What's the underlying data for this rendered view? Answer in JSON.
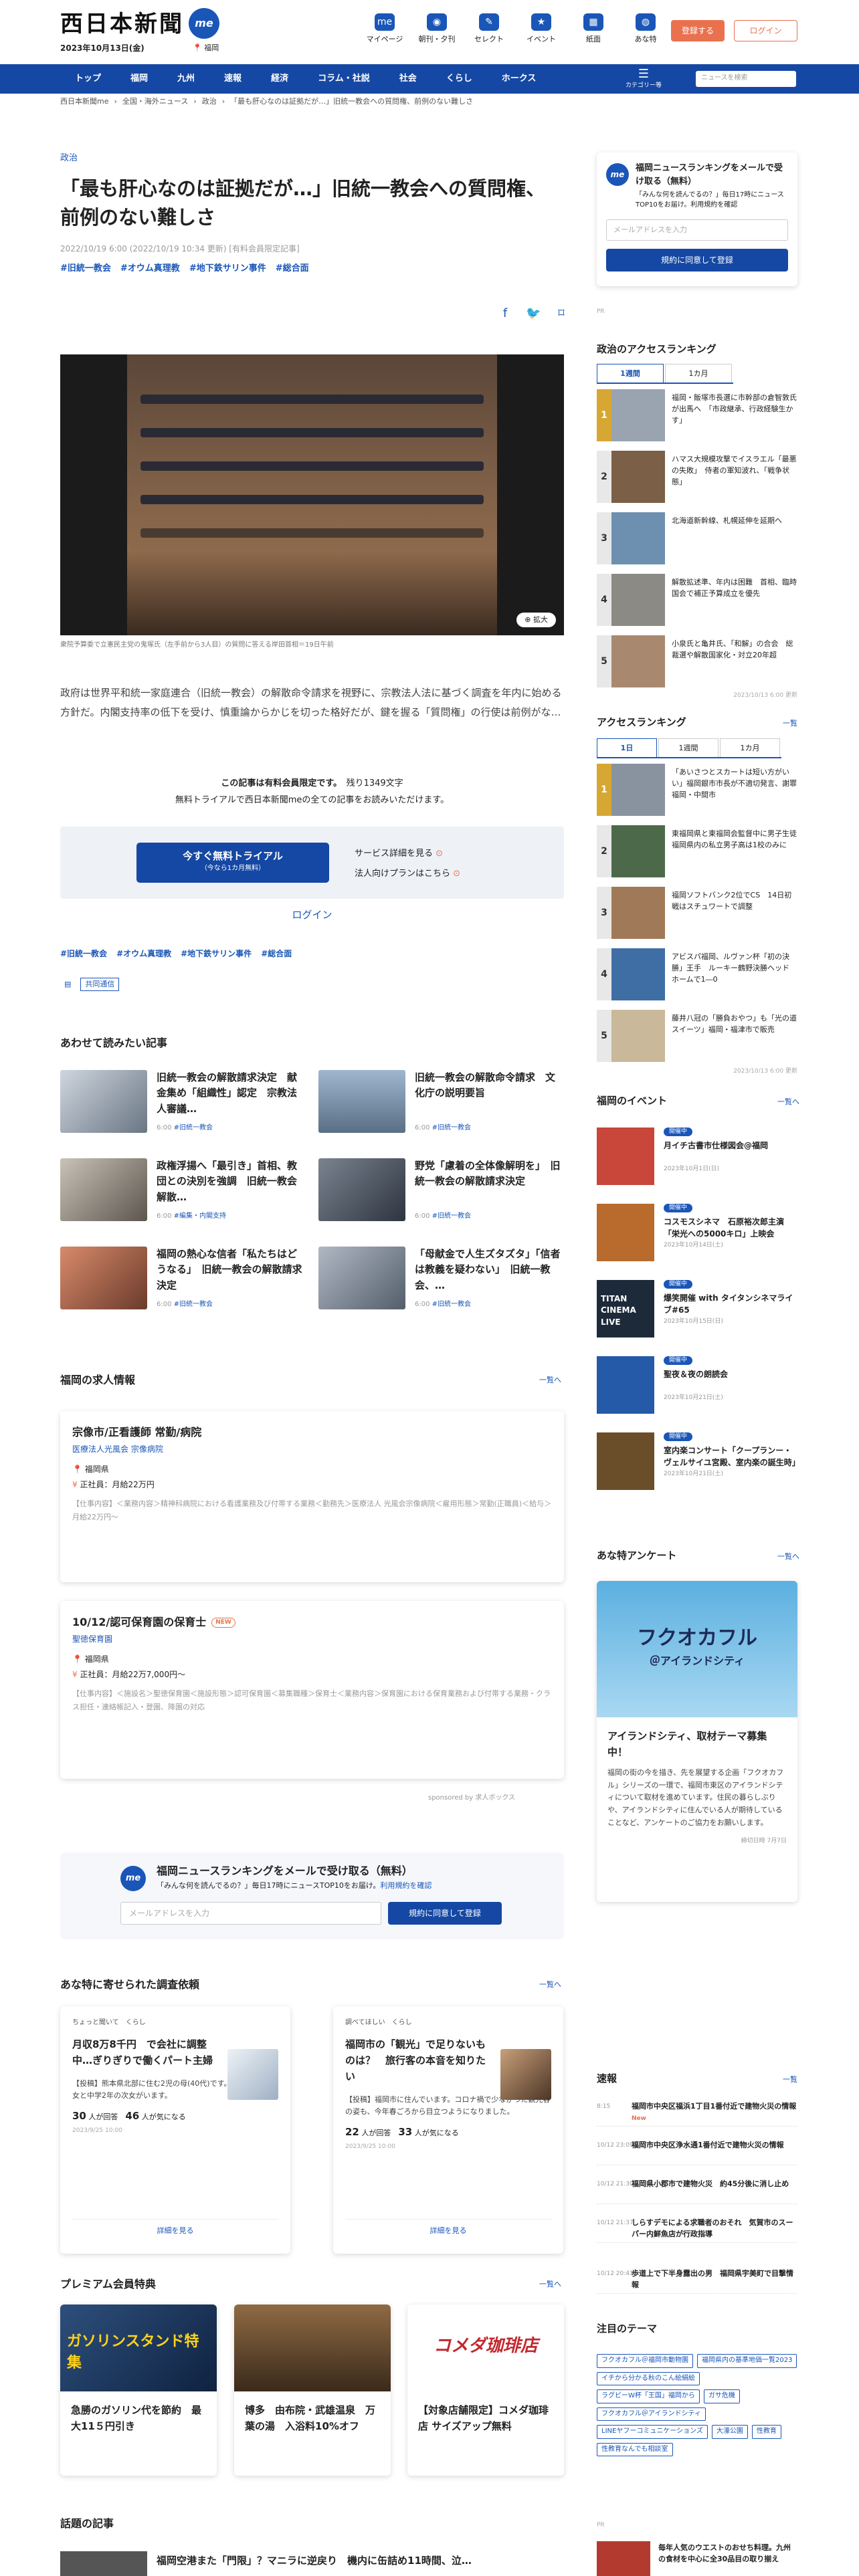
{
  "header": {
    "logo": "西日本新聞",
    "logo_me": "me",
    "date": "2023年10月13日(金)",
    "region": "福岡",
    "nav": [
      {
        "icon": "me",
        "label": "マイページ"
      },
      {
        "icon": "◉",
        "label": "朝刊・夕刊"
      },
      {
        "icon": "✎",
        "label": "セレクト"
      },
      {
        "icon": "★",
        "label": "イベント"
      },
      {
        "icon": "▦",
        "label": "紙面"
      },
      {
        "icon": "◍",
        "label": "あな特"
      }
    ],
    "register": "登録する",
    "login": "ログイン"
  },
  "navbar": {
    "items": [
      "トップ",
      "福岡",
      "九州",
      "速報",
      "経済",
      "コラム・社説",
      "社会",
      "くらし",
      "ホークス"
    ],
    "menu": "カテゴリー等",
    "search_placeholder": "ニュースを検索"
  },
  "breadcrumb": [
    "西日本新聞me",
    "全国・海外ニュース",
    "政治",
    "「最も肝心なのは証拠だが…」旧統一教会への質問権、前例のない難しさ"
  ],
  "article": {
    "category": "政治",
    "title": "「最も肝心なのは証拠だが…」旧統一教会への質問権、前例のない難しさ",
    "meta": "2022/10/19 6:00 (2022/10/19 10:34 更新) [有料会員限定記事]",
    "tags": [
      "#旧統一教会",
      "#オウム真理教",
      "#地下鉄サリン事件",
      "#総合面"
    ],
    "zoom": "拡大",
    "caption": "衆院予算委で立憲民主党の鬼塚氏（左手前から3人目）の質問に答える岸田首相＝19日午前",
    "body": "政府は世界平和統一家庭連合（旧統一教会）の解散命令請求を視野に、宗教法人法に基づく調査を年内に始める方針だ。内閣支持率の低下を受け、慎重論からかじを切った格好だが、鍵を握る「質問権」の行使は前例がな…",
    "members_only": "この記事は有料会員限定です。",
    "remaining": "残り1349文字",
    "trial_note": "無料トライアルで西日本新聞meの全ての記事をお読みいただけます。",
    "trial_button": "今すぐ無料トライアル",
    "trial_sub": "（今なら1カ月無料）",
    "service_link": "サービス詳細を見る",
    "corp_link": "法人向けプランはこちら",
    "login": "ログイン",
    "source": "共同通信"
  },
  "related": {
    "title": "あわせて読みたい記事",
    "items": [
      {
        "title": "旧統一教会の解散請求決定　献金集め「組織性」認定　宗教法人審議…",
        "date": "6:00",
        "tag": "#旧統一教会"
      },
      {
        "title": "旧統一教会の解散命令請求　文化庁の説明要旨",
        "date": "6:00",
        "tag": "#旧統一教会"
      },
      {
        "title": "政権浮揚へ「最引き」首相、教団との決別を強調　旧統一教会解散…",
        "date": "6:00",
        "tag": "#編集・内閣支持"
      },
      {
        "title": "野党「慮着の全体像解明を」　旧統一教会の解散請求決定",
        "date": "6:00",
        "tag": "#旧統一教会"
      },
      {
        "title": "福岡の熱心な信者「私たちはどうなる」　旧統一教会の解散請求決定",
        "date": "6:00",
        "tag": "#旧統一教会"
      },
      {
        "title": "「母献金で人生ズタズタ」「信者は教義を疑わない」　旧統一教会、…",
        "date": "6:00",
        "tag": "#旧統一教会"
      }
    ]
  },
  "jobs": {
    "title": "福岡の求人情報",
    "more": "一覧へ",
    "items": [
      {
        "title": "宗像市/正看護師 常勤/病院",
        "company": "医療法人光風会 宗像病院",
        "location": "福岡県",
        "salary": "正社員：月給22万円",
        "new": "",
        "desc": "【仕事内容】＜業務内容＞精神科病院における看護業務及び付帯する業務＜勤務先＞医療法人 光風会宗像病院＜雇用形態＞常勤(正職員)＜給与＞月給22万円～"
      },
      {
        "title": "10/12/認可保育園の保育士",
        "company": "聖徳保育園",
        "location": "福岡県",
        "salary": "正社員：月給22万7,000円～",
        "new": "NEW",
        "desc": "【仕事内容】＜施設名＞聖徳保育園＜施設形態＞認可保育園＜募集職種＞保育士＜業務内容＞保育園における保育業務および付帯する業務・クラス担任・連絡帳記入・登園、降園の対応"
      }
    ],
    "sponsored": "sponsored by 求人ボックス"
  },
  "newsletter_main": {
    "me": "me",
    "title": "福岡ニュースランキングをメールで受け取る（無料）",
    "desc": "「みんな何を読んでるの？」毎日17時にニュースTOP10をお届け。",
    "terms": "利用規約を確認",
    "placeholder": "メールアドレスを入力",
    "button": "規約に同意して登録"
  },
  "surveys": {
    "title": "あな特に寄せられた調査依頼",
    "more": "一覧へ",
    "items": [
      {
        "who": "ちょっと聞いて　くらし",
        "q": "月収8万8千円　で会社に調整中…ぎりぎりで働くパート主婦",
        "d": "【投稿】熊本県北部に住む2児の母(40代)です。高校3年の長女と中学2年の次女がいます。",
        "a": "30",
        "b": "46",
        "date": "2023/9/25 10:00",
        "btn": "詳細を見る"
      },
      {
        "who": "調べてほしい　くらし",
        "q": "福岡市の「観光」で足りないものは？　旅行客の本音を知りたい",
        "d": "【投稿】福岡市に住んでいます。コロナ禍で少なかった観光客の姿も、今年春ごろから目立つようになりました。",
        "a": "22",
        "b": "33",
        "date": "2023/9/25 10:00",
        "btn": "詳細を見る"
      }
    ]
  },
  "premium": {
    "title": "プレミアム会員特典",
    "more": "一覧へ",
    "items": [
      {
        "label": "ガソリンスタンド特集",
        "title": "急勝のガソリン代を節約　最大11５円引き"
      },
      {
        "label": "",
        "title": "博多　由布院・武雄温泉　万葉の湯　入浴料10%オフ"
      },
      {
        "label": "コメダ珈琲店",
        "title": "【対象店舗限定】コメダ珈琲店 サイズアップ無料"
      }
    ]
  },
  "topics": {
    "title": "話題の記事",
    "item": "福岡空港また「門限」？マニラに逆戻り　機内に缶詰め11時間、泣…"
  },
  "sidebar": {
    "newsletter": {
      "title": "福岡ニュースランキングをメールで受け取る（無料）",
      "desc": "「みんな何を読んでるの？」毎日17時にニュースTOP10をお届け。利用規約を確認",
      "placeholder": "メールアドレスを入力",
      "button": "規約に同意して登録"
    },
    "pr": "PR",
    "politics_rank": {
      "title": "政治のアクセスランキング",
      "tabs": [
        "1週間",
        "1カ月"
      ],
      "items": [
        "福岡・飯塚市長選に市幹部の倉智敦氏が出馬へ　「市政継承、行政経験生かす」",
        "ハマス大規模攻撃でイスラエル「最悪の失敗」　侍者の軍知波れ、「戦争状態」",
        "北海道新幹線、札幌延伸を延期へ",
        "解散拡述準、年内は困難　首相、臨時国会で補正予算成立を優先",
        "小泉氏と亀井氏、「和解」の合会　総裁選や解散国家化・対立20年超"
      ],
      "updated": "2023/10/13 6:00 更新"
    },
    "access_rank": {
      "title": "アクセスランキング",
      "more": "一覧",
      "tabs": [
        "1日",
        "1週間",
        "1カ月"
      ],
      "items": [
        "「あいさつとスカートは短い方がいい」福岡銀市市長が不適切発言、謝罪　福岡・中間市",
        "東福岡県と東福岡会監督中に男子生徒　福岡県内の私立男子高は1校のみに",
        "福岡ソフトバンク2位でCS　14日初戦はスチュワートで調整",
        "アビスパ福岡、ルヴァン杯「初の決勝」王手　ルーキー鶴野決勝ヘッド　ホームで1―0",
        "藤井八冠の「勝負おやつ」も「光の道スイーツ」福岡・福津市で販売"
      ],
      "updated": "2023/10/13 6:00 更新"
    },
    "events": {
      "title": "福岡のイベント",
      "more": "一覧へ",
      "items": [
        {
          "badge": "開催中",
          "title": "月イチ古書市仕様図会@福岡",
          "date": "2023年10月1日(日)"
        },
        {
          "badge": "開催中",
          "title": "コスモスシネマ　石原裕次郎主演「栄光への5000キロ」上映会",
          "date": "2023年10月14日(土)"
        },
        {
          "badge": "開催中",
          "title": "爆笑開催 with タイタンシネマライブ#65",
          "date": "2023年10月15日(日)"
        },
        {
          "badge": "開催中",
          "title": "聖夜＆夜の朗読会",
          "date": "2023年10月21日(土)"
        },
        {
          "badge": "開催中",
          "title": "室内楽コンサート「クープランー・ヴェルサイユ宮殿、室内楽の誕生時」",
          "date": "2023年10月21日(土)"
        }
      ]
    },
    "enquete": {
      "title": "あな特アンケート",
      "more": "一覧へ",
      "image_text": "フクオカフル",
      "image_sub": "＠アイランドシティ",
      "heading": "アイランドシティ、取材テーマ募集中！",
      "desc": "福岡の街の今を描き、先を展望する企画「フクオカフル」シリーズの一環で、福岡市東区のアイランドシティについて取材を進めています。住民の暮らしぶりや、アイランドシティに住んでいる人が期待していることなど、アンケートのご協力をお願いします。",
      "deadline": "締切日時 7月7日"
    },
    "quick": {
      "title": "速報",
      "more": "一覧",
      "items": [
        {
          "time": "8:15",
          "title": "福岡市中央区福浜1丁目1番付近で建物火災の情報"
        },
        {
          "time": "10/12 23:09",
          "title": "福岡市中央区浄水通1番付近で建物火災の情報"
        },
        {
          "time": "10/12 21:30",
          "title": "福岡県小郡市で建物火災　約45分後に消し止め"
        },
        {
          "time": "10/12 21:37",
          "title": "しらすデモによる求職者のおそれ　気賀市のスーパー内鮮魚店が行政指導"
        },
        {
          "time": "10/12 20:41",
          "title": "歩道上で下半身露出の男　福岡県宇美町で目撃情報"
        }
      ]
    },
    "themes": {
      "title": "注目のテーマ",
      "items": [
        "フクオカフル＠福岡市動物園",
        "福岡県内の基準地価一覧2023",
        "イチから分かる秋のこん絵絹絵",
        "ラグビーW杯「王国」福岡から",
        "ガサ危機",
        "フクオカフル＠アイランドシティ",
        "LINEヤフーコミュニケーションズ",
        "大濠公園",
        "性教育",
        "性教育なんでも相談室"
      ]
    },
    "bottom_pr": "毎年人気のウエストのおせち料理。九州の食材を中心に全30品目の取り揃え"
  },
  "colors": {
    "brand": "#1548a4",
    "accent": "#e9714e"
  }
}
